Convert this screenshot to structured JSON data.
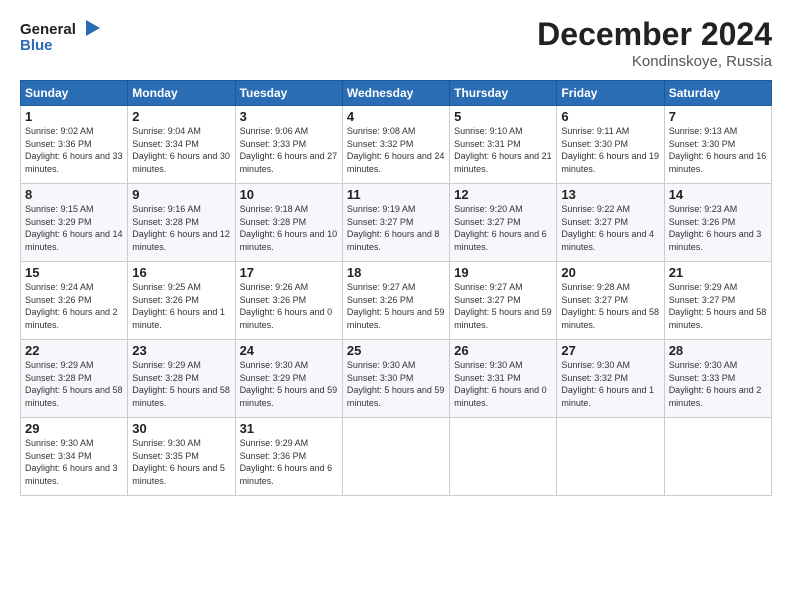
{
  "header": {
    "logo_line1": "General",
    "logo_line2": "Blue",
    "month": "December 2024",
    "location": "Kondinskoye, Russia"
  },
  "weekdays": [
    "Sunday",
    "Monday",
    "Tuesday",
    "Wednesday",
    "Thursday",
    "Friday",
    "Saturday"
  ],
  "weeks": [
    [
      {
        "day": "1",
        "sunrise": "9:02 AM",
        "sunset": "3:36 PM",
        "daylight": "6 hours and 33 minutes."
      },
      {
        "day": "2",
        "sunrise": "9:04 AM",
        "sunset": "3:34 PM",
        "daylight": "6 hours and 30 minutes."
      },
      {
        "day": "3",
        "sunrise": "9:06 AM",
        "sunset": "3:33 PM",
        "daylight": "6 hours and 27 minutes."
      },
      {
        "day": "4",
        "sunrise": "9:08 AM",
        "sunset": "3:32 PM",
        "daylight": "6 hours and 24 minutes."
      },
      {
        "day": "5",
        "sunrise": "9:10 AM",
        "sunset": "3:31 PM",
        "daylight": "6 hours and 21 minutes."
      },
      {
        "day": "6",
        "sunrise": "9:11 AM",
        "sunset": "3:30 PM",
        "daylight": "6 hours and 19 minutes."
      },
      {
        "day": "7",
        "sunrise": "9:13 AM",
        "sunset": "3:30 PM",
        "daylight": "6 hours and 16 minutes."
      }
    ],
    [
      {
        "day": "8",
        "sunrise": "9:15 AM",
        "sunset": "3:29 PM",
        "daylight": "6 hours and 14 minutes."
      },
      {
        "day": "9",
        "sunrise": "9:16 AM",
        "sunset": "3:28 PM",
        "daylight": "6 hours and 12 minutes."
      },
      {
        "day": "10",
        "sunrise": "9:18 AM",
        "sunset": "3:28 PM",
        "daylight": "6 hours and 10 minutes."
      },
      {
        "day": "11",
        "sunrise": "9:19 AM",
        "sunset": "3:27 PM",
        "daylight": "6 hours and 8 minutes."
      },
      {
        "day": "12",
        "sunrise": "9:20 AM",
        "sunset": "3:27 PM",
        "daylight": "6 hours and 6 minutes."
      },
      {
        "day": "13",
        "sunrise": "9:22 AM",
        "sunset": "3:27 PM",
        "daylight": "6 hours and 4 minutes."
      },
      {
        "day": "14",
        "sunrise": "9:23 AM",
        "sunset": "3:26 PM",
        "daylight": "6 hours and 3 minutes."
      }
    ],
    [
      {
        "day": "15",
        "sunrise": "9:24 AM",
        "sunset": "3:26 PM",
        "daylight": "6 hours and 2 minutes."
      },
      {
        "day": "16",
        "sunrise": "9:25 AM",
        "sunset": "3:26 PM",
        "daylight": "6 hours and 1 minute."
      },
      {
        "day": "17",
        "sunrise": "9:26 AM",
        "sunset": "3:26 PM",
        "daylight": "6 hours and 0 minutes."
      },
      {
        "day": "18",
        "sunrise": "9:27 AM",
        "sunset": "3:26 PM",
        "daylight": "5 hours and 59 minutes."
      },
      {
        "day": "19",
        "sunrise": "9:27 AM",
        "sunset": "3:27 PM",
        "daylight": "5 hours and 59 minutes."
      },
      {
        "day": "20",
        "sunrise": "9:28 AM",
        "sunset": "3:27 PM",
        "daylight": "5 hours and 58 minutes."
      },
      {
        "day": "21",
        "sunrise": "9:29 AM",
        "sunset": "3:27 PM",
        "daylight": "5 hours and 58 minutes."
      }
    ],
    [
      {
        "day": "22",
        "sunrise": "9:29 AM",
        "sunset": "3:28 PM",
        "daylight": "5 hours and 58 minutes."
      },
      {
        "day": "23",
        "sunrise": "9:29 AM",
        "sunset": "3:28 PM",
        "daylight": "5 hours and 58 minutes."
      },
      {
        "day": "24",
        "sunrise": "9:30 AM",
        "sunset": "3:29 PM",
        "daylight": "5 hours and 59 minutes."
      },
      {
        "day": "25",
        "sunrise": "9:30 AM",
        "sunset": "3:30 PM",
        "daylight": "5 hours and 59 minutes."
      },
      {
        "day": "26",
        "sunrise": "9:30 AM",
        "sunset": "3:31 PM",
        "daylight": "6 hours and 0 minutes."
      },
      {
        "day": "27",
        "sunrise": "9:30 AM",
        "sunset": "3:32 PM",
        "daylight": "6 hours and 1 minute."
      },
      {
        "day": "28",
        "sunrise": "9:30 AM",
        "sunset": "3:33 PM",
        "daylight": "6 hours and 2 minutes."
      }
    ],
    [
      {
        "day": "29",
        "sunrise": "9:30 AM",
        "sunset": "3:34 PM",
        "daylight": "6 hours and 3 minutes."
      },
      {
        "day": "30",
        "sunrise": "9:30 AM",
        "sunset": "3:35 PM",
        "daylight": "6 hours and 5 minutes."
      },
      {
        "day": "31",
        "sunrise": "9:29 AM",
        "sunset": "3:36 PM",
        "daylight": "6 hours and 6 minutes."
      },
      null,
      null,
      null,
      null
    ]
  ]
}
